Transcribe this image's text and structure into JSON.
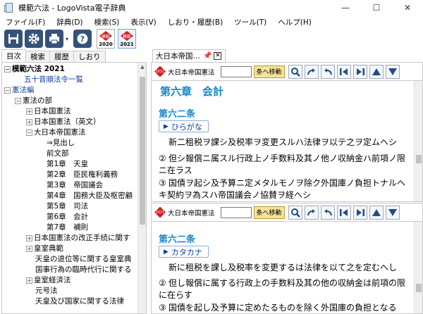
{
  "window": {
    "title": "模範六法 - LogoVista電子辞典",
    "minimize": "—",
    "maximize": "☐",
    "close": "✕"
  },
  "menu": [
    "ファイル(F)",
    "辞典(D)",
    "検索(S)",
    "表示(V)",
    "しおり・履歴(B)",
    "ツール(T)",
    "ヘルプ(H)"
  ],
  "toolbar": {
    "books": [
      {
        "seal": "模範",
        "year": "2020"
      },
      {
        "seal": "模範",
        "year": "2021"
      }
    ]
  },
  "left_tabs": [
    "目次",
    "検索",
    "履歴",
    "しおり"
  ],
  "tree": [
    {
      "text": "模範六法 2021",
      "style": "bold",
      "indent": 0,
      "toggle": "−"
    },
    {
      "text": "五十音順法令一覧",
      "style": "blue",
      "indent": 1,
      "toggle": ""
    },
    {
      "text": "憲法編",
      "style": "blue",
      "indent": 0,
      "toggle": "−"
    },
    {
      "text": "憲法の部",
      "style": "",
      "indent": 1,
      "toggle": "−"
    },
    {
      "text": "日本国憲法",
      "style": "",
      "indent": 2,
      "toggle": "+"
    },
    {
      "text": "日本国憲法（英文）",
      "style": "",
      "indent": 2,
      "toggle": "+"
    },
    {
      "text": "大日本帝国憲法",
      "style": "",
      "indent": 2,
      "toggle": "−"
    },
    {
      "text": "⇒見出し",
      "style": "",
      "indent": 3,
      "toggle": ""
    },
    {
      "text": "前文部",
      "style": "",
      "indent": 3,
      "toggle": ""
    },
    {
      "text": "第1章　天皇",
      "style": "",
      "indent": 3,
      "toggle": ""
    },
    {
      "text": "第2章　臣民権利義務",
      "style": "",
      "indent": 3,
      "toggle": ""
    },
    {
      "text": "第3章　帝国議会",
      "style": "",
      "indent": 3,
      "toggle": ""
    },
    {
      "text": "第4章　国務大臣及枢密顧",
      "style": "",
      "indent": 3,
      "toggle": ""
    },
    {
      "text": "第5章　司法",
      "style": "",
      "indent": 3,
      "toggle": ""
    },
    {
      "text": "第6章　会計",
      "style": "",
      "indent": 3,
      "toggle": ""
    },
    {
      "text": "第7章　補則",
      "style": "",
      "indent": 3,
      "toggle": ""
    },
    {
      "text": "日本国憲法の改正手続に関す",
      "style": "",
      "indent": 2,
      "toggle": "+"
    },
    {
      "text": "皇室典範",
      "style": "",
      "indent": 2,
      "toggle": "+"
    },
    {
      "text": "天皇の退位等に関する皇室典",
      "style": "",
      "indent": 2,
      "toggle": ""
    },
    {
      "text": "国事行為の臨時代行に関する",
      "style": "",
      "indent": 2,
      "toggle": ""
    },
    {
      "text": "皇室経済法",
      "style": "",
      "indent": 2,
      "toggle": "+"
    },
    {
      "text": "元号法",
      "style": "",
      "indent": 2,
      "toggle": ""
    },
    {
      "text": "天皇及び国家に関する法律",
      "style": "",
      "indent": 2,
      "toggle": ""
    }
  ],
  "doc_tab": {
    "label": "大日本帝国…",
    "pin": "📌",
    "close": "✕"
  },
  "pane_header": {
    "book_title": "大日本帝国憲法",
    "go_button": "条へ移動",
    "seal": "2021"
  },
  "pane_top": {
    "chapter": "第六章　会計",
    "article": "第六二条",
    "toggle_label": "ひらがな",
    "paragraphs": [
      {
        "num": "",
        "text": "新二租税ヲ課シ及税率ヲ変更スルハ法律ヲ以テ之ヲ定ムヘシ"
      },
      {
        "num": "②",
        "text": "但シ報償ニ属スル行政上ノ手数料及其ノ他ノ収納金ハ前項ノ限ニ在ラス"
      },
      {
        "num": "③",
        "text": "国債ヲ起シ及予算ニ定メタルモノヲ除ク外国庫ノ負担トナルヘキ契約ヲ為スハ帝国議会ノ協賛ヲ経ヘシ"
      }
    ]
  },
  "pane_bottom": {
    "article": "第六二条",
    "toggle_label": "カタカナ",
    "paragraphs": [
      {
        "num": "",
        "text": "新に租税を課し及税率を変更するは法律を以て之を定むへし"
      },
      {
        "num": "②",
        "text": "但し報償に属する行政上の手数料及其の他の収納金は前項の限に在らす"
      },
      {
        "num": "③",
        "text": "国債を起し及予算に定めたるものを除く外国庫の負担となる"
      }
    ]
  }
}
